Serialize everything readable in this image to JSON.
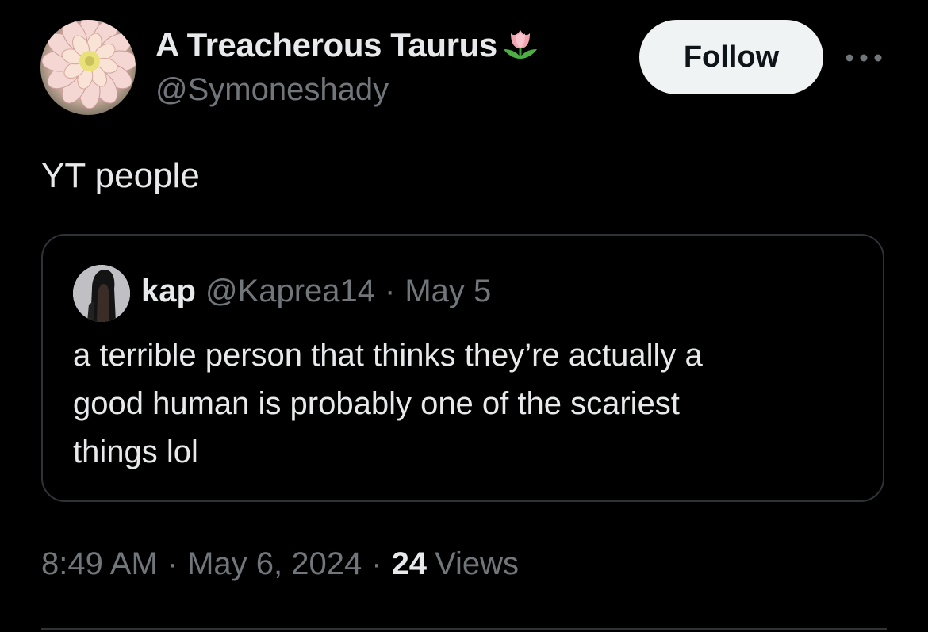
{
  "author": {
    "display_name": "A Treacherous Taurus",
    "name_emoji": "tulip-icon",
    "handle": "@Symoneshady",
    "avatar": "flower-avatar"
  },
  "actions": {
    "follow_label": "Follow",
    "more_icon": "more-horizontal-icon"
  },
  "tweet": {
    "text": "YT people"
  },
  "quoted_tweet": {
    "name": "kap",
    "handle": "@Kaprea14",
    "separator": "·",
    "date": "May 5",
    "lines": [
      "a terrible person that thinks they’re actually a",
      "good human is probably one of the scariest",
      "things lol"
    ]
  },
  "meta": {
    "time": "8:49 AM",
    "separator": "·",
    "date": "May 6, 2024",
    "views_count": "24",
    "views_label": "Views"
  },
  "colors": {
    "background": "#000000",
    "primary_text": "#e7e9ea",
    "secondary_text": "#71767b",
    "border": "#2f3336",
    "follow_button_bg": "#eff3f4"
  }
}
